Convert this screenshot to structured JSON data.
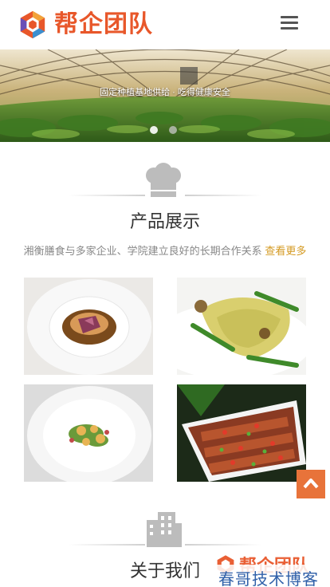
{
  "header": {
    "logo_text": "帮企团队",
    "logo_icon": "hexagon-logo-icon",
    "menu_icon": "hamburger-menu-icon"
  },
  "banner": {
    "caption": "固定种植基地供给 · 吃得健康安全",
    "slides_total": 2,
    "active_slide": 1
  },
  "products": {
    "title": "产品展示",
    "icon": "chef-hat-icon",
    "description": "湘衡膳食与多家企业、学院建立良好的长期合作关系",
    "more_label": "查看更多"
  },
  "about": {
    "title": "关于我们",
    "icon": "building-icon"
  },
  "back_to_top_icon": "chevron-up-icon",
  "watermark": {
    "text": "春哥技术博客",
    "logo_text": "帮企团队"
  },
  "colors": {
    "accent": "#e8733a",
    "link": "#d49a22",
    "logo": "#e8572a"
  }
}
